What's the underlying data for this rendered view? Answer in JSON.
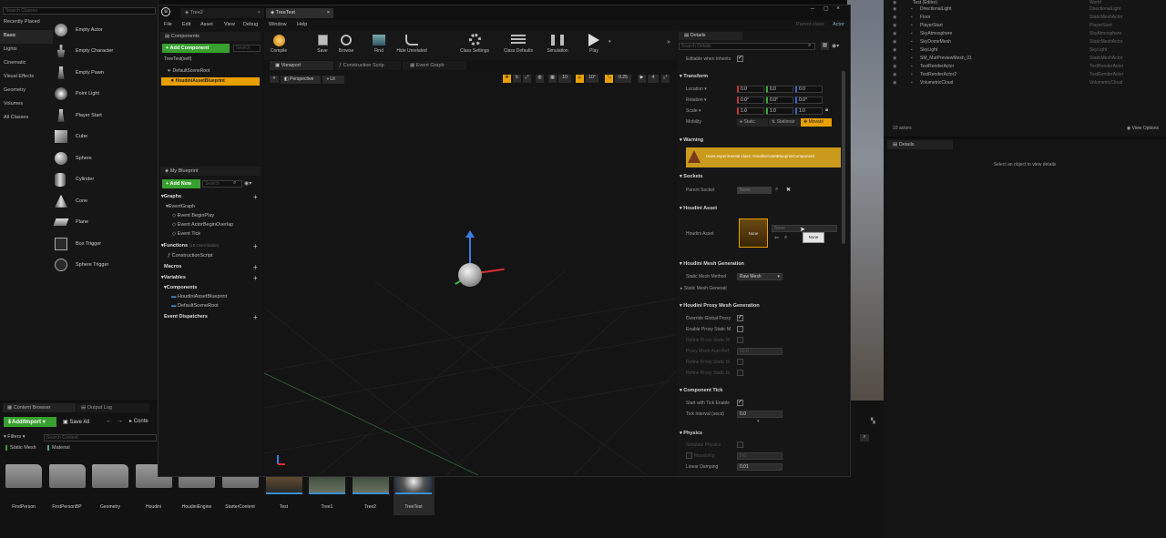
{
  "colors": {
    "accent": "#e8a000",
    "green": "#37a02e",
    "warning": "#c99a1c",
    "dark": "#141414"
  },
  "place": {
    "search_placeholder": "Search Classes",
    "categories": [
      "Recently Placed",
      "Basic",
      "Lights",
      "Cinematic",
      "Visual Effects",
      "Geometry",
      "Volumes",
      "All Classes"
    ],
    "items": [
      "Empty Actor",
      "Empty Character",
      "Empty Pawn",
      "Point Light",
      "Player Start",
      "Cube",
      "Sphere",
      "Cylinder",
      "Cone",
      "Plane",
      "Box Trigger",
      "Sphere Trigger"
    ]
  },
  "outliner": {
    "root": "Test (Editor)",
    "root_type": "World",
    "rows": [
      {
        "label": "DirectionalLight",
        "type": "DirectionalLight"
      },
      {
        "label": "Floor",
        "type": "StaticMeshActor"
      },
      {
        "label": "PlayerStart",
        "type": "PlayerStart"
      },
      {
        "label": "SkyAtmosphere",
        "type": "SkyAtmosphere"
      },
      {
        "label": "SkyDomeMesh",
        "type": "StaticMeshActor"
      },
      {
        "label": "SkyLight",
        "type": "SkyLight"
      },
      {
        "label": "SM_MatPreviewMesh_01",
        "type": "StaticMeshActor"
      },
      {
        "label": "TextRenderActor",
        "type": "TextRenderActor"
      },
      {
        "label": "TextRenderActor2",
        "type": "TextRenderActor"
      },
      {
        "label": "VolumetricCloud",
        "type": "VolumetricCloud"
      }
    ],
    "count": "10 actors",
    "view_options": "View Options"
  },
  "level_details": {
    "tab": "Details",
    "empty_msg": "Select an object to view details"
  },
  "content": {
    "tab_browser": "Content Browser",
    "tab_log": "Output Log",
    "add_import": "Add/Import",
    "save_all": "Save All",
    "path": "Conte",
    "filters": "Filters",
    "search_placeholder": "Search Content",
    "filter_chips": [
      "Static Mesh",
      "Material"
    ],
    "folders": [
      "FirstPerson",
      "FirstPersonBP",
      "Geometry",
      "Houdini",
      "HoudiniEngine",
      "StarterContent"
    ],
    "assets": [
      "Test",
      "Tree1",
      "Tree2",
      "TreeTest"
    ]
  },
  "bp": {
    "tabs": [
      "Tree2",
      "TreeTest"
    ],
    "parent_class": "Parent class:",
    "parent_value": "Actor",
    "menu": [
      "File",
      "Edit",
      "Asset",
      "View",
      "Debug",
      "Window",
      "Help"
    ],
    "components_title": "Components",
    "add_component": "+ Add Component",
    "search": "Search",
    "comp_self": "TreeTest(self)",
    "comp_root": "DefaultSceneRoot",
    "comp_houdini": "HoudiniAssetBlueprint",
    "toolbar": [
      "Compile",
      "Save",
      "Browse",
      "Find",
      "Hide Unrelated",
      "Class Settings",
      "Class Defaults",
      "Simulation",
      "Play"
    ],
    "viewport_tabs": [
      "Viewport",
      "Construction Scrip",
      "Event Graph"
    ],
    "perspective": "Perspective",
    "lit": "Lit",
    "vp_nums": [
      "10",
      "10°",
      "0.25",
      "4"
    ],
    "mybp_title": "My Blueprint",
    "add_new": "+ Add New",
    "graphs": "Graphs",
    "event_graph": "EventGraph",
    "events": [
      "Event BeginPlay",
      "Event ActorBeginOverlap",
      "Event Tick"
    ],
    "functions": "Functions",
    "functions_note": "(18 Overridable)",
    "construction": "ConstructionScript",
    "macros": "Macros",
    "variables": "Variables",
    "components": "Components",
    "vars": [
      "HoudiniAssetBlueprint",
      "DefaultSceneRoot"
    ],
    "dispatchers": "Event Dispatchers"
  },
  "details": {
    "tab": "Details",
    "search_placeholder": "Search Details",
    "editable_label": "Editable when Inherits",
    "transform": "Transform",
    "location": {
      "label": "Location",
      "x": "0.0",
      "y": "0.0",
      "z": "0.0"
    },
    "rotation": {
      "label": "Rotation",
      "x": "0.0°",
      "y": "0.0°",
      "z": "0.0°"
    },
    "scale": {
      "label": "Scale",
      "x": "1.0",
      "y": "1.0",
      "z": "1.0"
    },
    "mobility": {
      "label": "Mobility",
      "opts": [
        "Static",
        "Stationar",
        "Movabl"
      ]
    },
    "warning": "Warning",
    "warning_text": "Uses experimental class: HoudiniAssetBlueprintComponent",
    "sockets": "Sockets",
    "parent_socket": "Parent Socket",
    "none": "None",
    "houdini_asset_sec": "Houdini Asset",
    "houdini_asset": "Houdini Asset",
    "asset_none": "None",
    "dropdown_none": "None",
    "tooltip": "None",
    "mesh_gen": "Houdini Mesh Generation",
    "static_method": "Static Mesh Method",
    "method_value": "Raw Mesh",
    "static_gen": "Static Mesh Generati",
    "proxy_gen": "Houdini Proxy Mesh Generation",
    "proxy_rows": [
      "Override Global Proxy",
      "Enable Proxy Static M",
      "Refine Proxy Static M",
      "Proxy Mesh Auto Ref",
      "Refine Proxy Static M",
      "Refine Proxy Static M"
    ],
    "proxy_value": "10.0",
    "comp_tick": "Component Tick",
    "tick_enable": "Start with Tick Enable",
    "tick_interval": "Tick Interval (secs)",
    "tick_value": "0.0",
    "physics": "Physics",
    "sim_physics": "Simulate Physics",
    "mass": "MassInKg",
    "mass_value": "0.0",
    "linear_damping": "Linear Damping",
    "damping_value": "0.01"
  }
}
